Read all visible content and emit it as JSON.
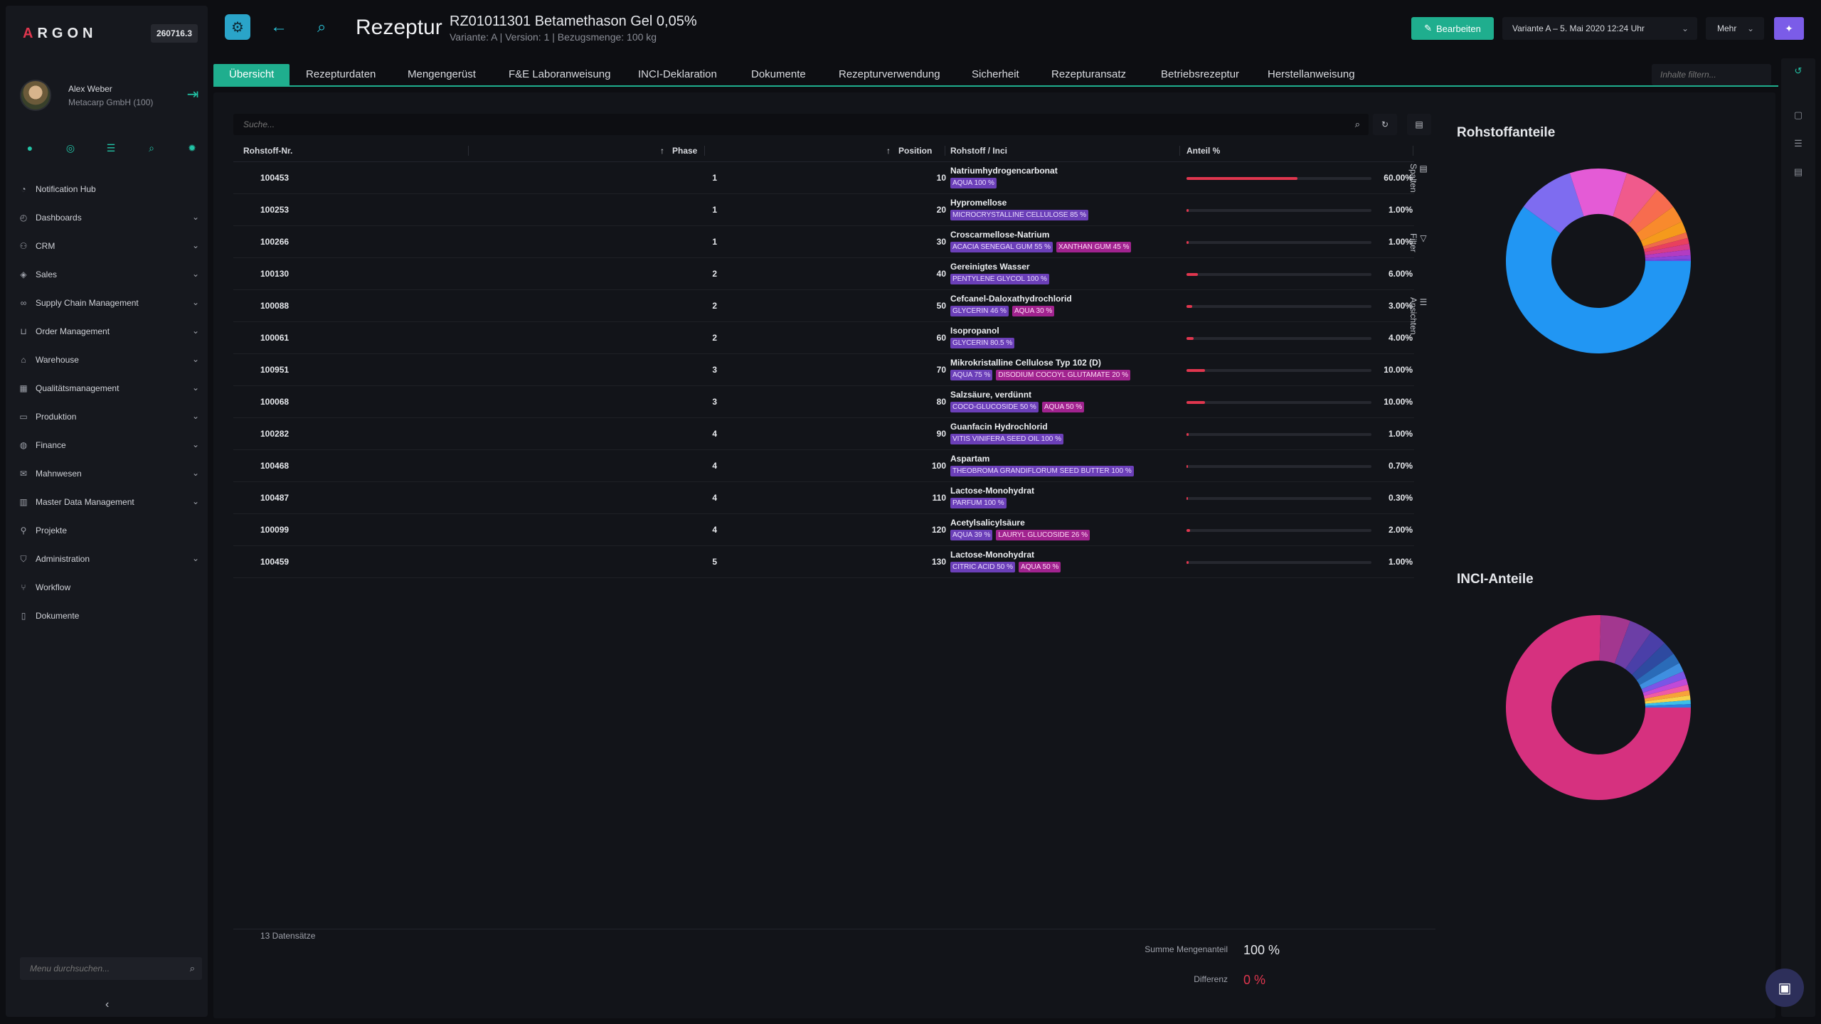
{
  "sidebar": {
    "brand_a": "A",
    "brand_rest": "RGON",
    "version": "260716.3",
    "user_name": "Alex Weber",
    "user_company": "Metacarp GmbH (100)",
    "menu_search_placeholder": "Menu durchsuchen...",
    "items": [
      {
        "label": "Notification Hub",
        "icon": "bell-icon",
        "expandable": false
      },
      {
        "label": "Dashboards",
        "icon": "dashboard-icon",
        "expandable": true
      },
      {
        "label": "CRM",
        "icon": "users-icon",
        "expandable": true
      },
      {
        "label": "Sales",
        "icon": "tag-icon",
        "expandable": true
      },
      {
        "label": "Supply Chain Management",
        "icon": "link-icon",
        "expandable": true
      },
      {
        "label": "Order Management",
        "icon": "cart-icon",
        "expandable": true
      },
      {
        "label": "Warehouse",
        "icon": "warehouse-icon",
        "expandable": true
      },
      {
        "label": "Qualitätsmanagement",
        "icon": "quality-icon",
        "expandable": true
      },
      {
        "label": "Produktion",
        "icon": "folder-icon",
        "expandable": true
      },
      {
        "label": "Finance",
        "icon": "coins-icon",
        "expandable": true
      },
      {
        "label": "Mahnwesen",
        "icon": "mail-icon",
        "expandable": true
      },
      {
        "label": "Master Data Management",
        "icon": "database-icon",
        "expandable": true
      },
      {
        "label": "Projekte",
        "icon": "pin-icon",
        "expandable": false
      },
      {
        "label": "Administration",
        "icon": "shield-icon",
        "expandable": true
      },
      {
        "label": "Workflow",
        "icon": "workflow-icon",
        "expandable": false
      },
      {
        "label": "Dokumente",
        "icon": "document-icon",
        "expandable": false
      }
    ]
  },
  "header": {
    "page_title": "Rezeptur",
    "record_title": "RZ01011301 Betamethason Gel 0,05%",
    "record_sub": "Variante: A | Version: 1 | Bezugsmenge: 100 kg",
    "edit_label": "Bearbeiten",
    "variant_label": "Variante A – 5. Mai 2020 12:24 Uhr",
    "more_label": "Mehr"
  },
  "tabs": [
    {
      "label": "Übersicht",
      "active": true
    },
    {
      "label": "Rezepturdaten",
      "active": false
    },
    {
      "label": "Mengengerüst",
      "active": false
    },
    {
      "label": "F&E Laboranweisung",
      "active": false
    },
    {
      "label": "INCI-Deklaration",
      "active": false
    },
    {
      "label": "Dokumente",
      "active": false
    },
    {
      "label": "Rezepturverwendung",
      "active": false
    },
    {
      "label": "Sicherheit",
      "active": false
    },
    {
      "label": "Rezepturansatz",
      "active": false
    },
    {
      "label": "Betriebsrezeptur",
      "active": false
    },
    {
      "label": "Herstellanweisung",
      "active": false
    }
  ],
  "filter_placeholder": "Inhalte filtern...",
  "table": {
    "search_placeholder": "Suche...",
    "headers": {
      "nr": "Rohstoff-Nr.",
      "phase": "Phase",
      "position": "Position",
      "name": "Rohstoff / Inci",
      "share": "Anteil %"
    },
    "rows": [
      {
        "nr": "100453",
        "phase": "1",
        "pos": "10",
        "name": "Natriumhydrogencarbonat",
        "tags": [
          {
            "t": "AQUA 100 %",
            "c": "purple"
          }
        ],
        "pct": "60.00%",
        "value": 60
      },
      {
        "nr": "100253",
        "phase": "1",
        "pos": "20",
        "name": "Hypromellose",
        "tags": [
          {
            "t": "MICROCRYSTALLINE CELLULOSE 85 %",
            "c": "purple"
          }
        ],
        "pct": "1.00%",
        "value": 1
      },
      {
        "nr": "100266",
        "phase": "1",
        "pos": "30",
        "name": "Croscarmellose-Natrium",
        "tags": [
          {
            "t": "ACACIA SENEGAL GUM 55 %",
            "c": "purple"
          },
          {
            "t": "XANTHAN GUM 45 %",
            "c": "pink"
          }
        ],
        "pct": "1.00%",
        "value": 1
      },
      {
        "nr": "100130",
        "phase": "2",
        "pos": "40",
        "name": "Gereinigtes Wasser",
        "tags": [
          {
            "t": "PENTYLENE GLYCOL 100 %",
            "c": "purple"
          }
        ],
        "pct": "6.00%",
        "value": 6
      },
      {
        "nr": "100088",
        "phase": "2",
        "pos": "50",
        "name": "Cefcanel-Daloxathydrochlorid",
        "tags": [
          {
            "t": "GLYCERIN 46 %",
            "c": "purple"
          },
          {
            "t": "AQUA 30 %",
            "c": "pink"
          }
        ],
        "pct": "3.00%",
        "value": 3
      },
      {
        "nr": "100061",
        "phase": "2",
        "pos": "60",
        "name": "Isopropanol",
        "tags": [
          {
            "t": "GLYCERIN 80.5 %",
            "c": "purple"
          }
        ],
        "pct": "4.00%",
        "value": 4
      },
      {
        "nr": "100951",
        "phase": "3",
        "pos": "70",
        "name": "Mikrokristalline Cellulose Typ 102 (D)",
        "tags": [
          {
            "t": "AQUA 75 %",
            "c": "purple"
          },
          {
            "t": "DISODIUM COCOYL GLUTAMATE 20 %",
            "c": "pink"
          }
        ],
        "pct": "10.00%",
        "value": 10
      },
      {
        "nr": "100068",
        "phase": "3",
        "pos": "80",
        "name": "Salzsäure, verdünnt",
        "tags": [
          {
            "t": "COCO-GLUCOSIDE 50 %",
            "c": "purple"
          },
          {
            "t": "AQUA 50 %",
            "c": "pink"
          }
        ],
        "pct": "10.00%",
        "value": 10
      },
      {
        "nr": "100282",
        "phase": "4",
        "pos": "90",
        "name": "Guanfacin Hydrochlorid",
        "tags": [
          {
            "t": "VITIS VINIFERA SEED OIL 100 %",
            "c": "purple"
          }
        ],
        "pct": "1.00%",
        "value": 1
      },
      {
        "nr": "100468",
        "phase": "4",
        "pos": "100",
        "name": "Aspartam",
        "tags": [
          {
            "t": "THEOBROMA GRANDIFLORUM SEED BUTTER 100 %",
            "c": "purple"
          }
        ],
        "pct": "0.70%",
        "value": 0.7
      },
      {
        "nr": "100487",
        "phase": "4",
        "pos": "110",
        "name": "Lactose-Monohydrat",
        "tags": [
          {
            "t": "PARFUM 100 %",
            "c": "purple"
          }
        ],
        "pct": "0.30%",
        "value": 0.3
      },
      {
        "nr": "100099",
        "phase": "4",
        "pos": "120",
        "name": "Acetylsalicylsäure",
        "tags": [
          {
            "t": "AQUA 39 %",
            "c": "purple"
          },
          {
            "t": "LAURYL GLUCOSIDE 26 %",
            "c": "pink"
          }
        ],
        "pct": "2.00%",
        "value": 2
      },
      {
        "nr": "100459",
        "phase": "5",
        "pos": "130",
        "name": "Lactose-Monohydrat",
        "tags": [
          {
            "t": "CITRIC ACID 50 %",
            "c": "purple"
          },
          {
            "t": "AQUA 50 %",
            "c": "pink"
          }
        ],
        "pct": "1.00%",
        "value": 1
      }
    ],
    "side_tabs": [
      "Spalten",
      "Filter",
      "Ansichten"
    ],
    "records": "13 Datensätze",
    "sum_label": "Summe Mengenanteil",
    "sum_value": "100 %",
    "diff_label": "Differenz",
    "diff_value": "0 %"
  },
  "chart_data": [
    {
      "type": "pie",
      "title": "Rohstoffanteile",
      "slices": [
        {
          "value": 60,
          "color": "#2196f3"
        },
        {
          "value": 10,
          "color": "#7e6cf0"
        },
        {
          "value": 10,
          "color": "#e45bd6"
        },
        {
          "value": 6,
          "color": "#f05a8c"
        },
        {
          "value": 4,
          "color": "#f76c4f"
        },
        {
          "value": 3,
          "color": "#f88a2d"
        },
        {
          "value": 2,
          "color": "#f59a1c"
        },
        {
          "value": 1,
          "color": "#ef6a4a"
        },
        {
          "value": 1,
          "color": "#e8405e"
        },
        {
          "value": 1,
          "color": "#d63b8a"
        },
        {
          "value": 1,
          "color": "#b23cc2"
        },
        {
          "value": 0.7,
          "color": "#8c44d8"
        },
        {
          "value": 0.3,
          "color": "#6b4ae0"
        }
      ]
    },
    {
      "type": "pie",
      "title": "INCI-Anteile",
      "slices": [
        {
          "value": 75.4,
          "color": "#d6317f"
        },
        {
          "value": 5.2,
          "color": "#a3378f"
        },
        {
          "value": 4.1,
          "color": "#6c3ea6"
        },
        {
          "value": 3.0,
          "color": "#4a3fa8"
        },
        {
          "value": 2.4,
          "color": "#2e4aa0"
        },
        {
          "value": 1.9,
          "color": "#2a6bb8"
        },
        {
          "value": 1.6,
          "color": "#3f8fe0"
        },
        {
          "value": 1.3,
          "color": "#7a55e6"
        },
        {
          "value": 1.1,
          "color": "#c04ad8"
        },
        {
          "value": 1.0,
          "color": "#f05aa6"
        },
        {
          "value": 0.9,
          "color": "#f7a23a"
        },
        {
          "value": 0.8,
          "color": "#f7d24a"
        },
        {
          "value": 0.7,
          "color": "#3cc0e8"
        },
        {
          "value": 0.6,
          "color": "#2d7de0"
        }
      ]
    }
  ],
  "colors": {
    "accent": "#1fae8e",
    "bar": "#e0364e",
    "purple": "#7b5ce8"
  }
}
